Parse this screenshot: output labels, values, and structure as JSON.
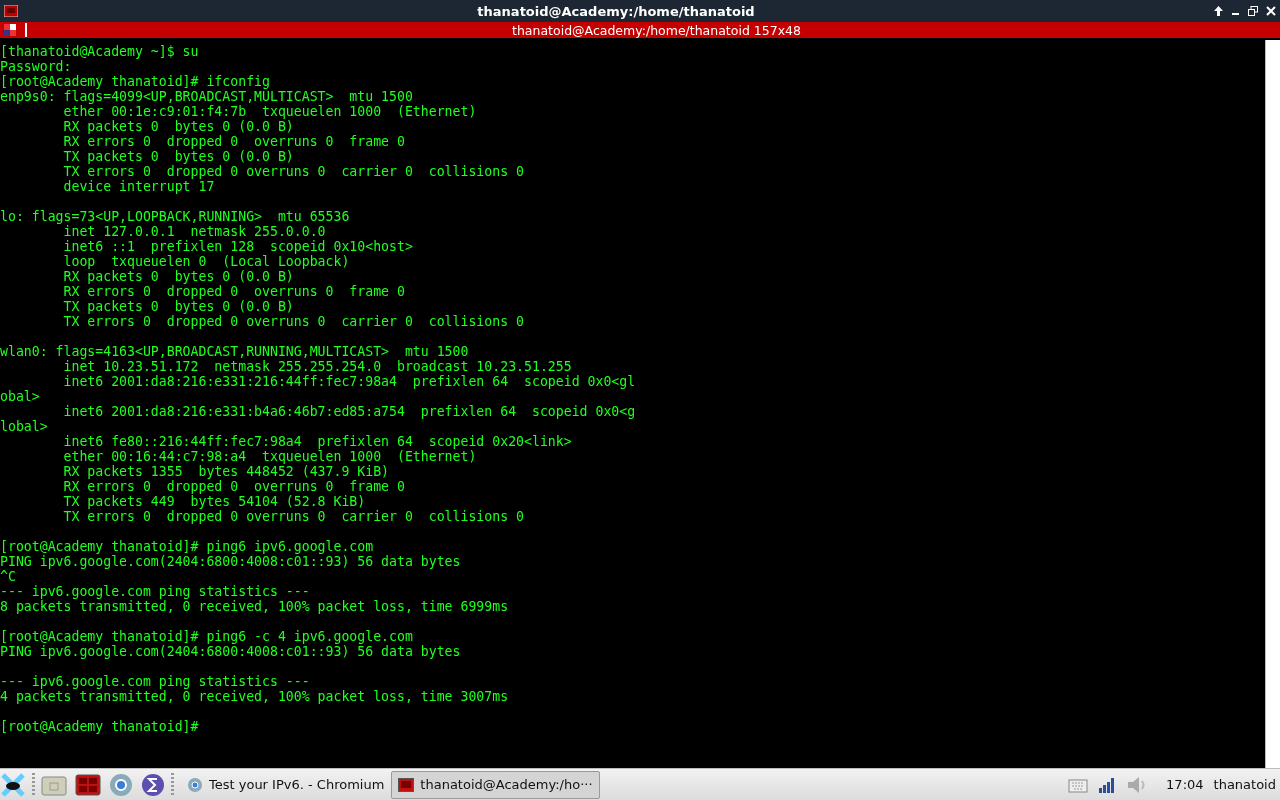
{
  "window": {
    "title": "thanatoid@Academy:/home/thanatoid"
  },
  "tab_bar": {
    "title": "thanatoid@Academy:/home/thanatoid 157x48"
  },
  "terminal": {
    "blocks": [
      [
        "[thanatoid@Academy ~]$ su",
        "Password:",
        "[root@Academy thanatoid]# ifconfig",
        "enp9s0: flags=4099<UP,BROADCAST,MULTICAST>  mtu 1500",
        "        ether 00:1e:c9:01:f4:7b  txqueuelen 1000  (Ethernet)",
        "        RX packets 0  bytes 0 (0.0 B)",
        "        RX errors 0  dropped 0  overruns 0  frame 0",
        "        TX packets 0  bytes 0 (0.0 B)",
        "        TX errors 0  dropped 0 overruns 0  carrier 0  collisions 0",
        "        device interrupt 17"
      ],
      [
        "lo: flags=73<UP,LOOPBACK,RUNNING>  mtu 65536",
        "        inet 127.0.0.1  netmask 255.0.0.0",
        "        inet6 ::1  prefixlen 128  scopeid 0x10<host>",
        "        loop  txqueuelen 0  (Local Loopback)",
        "        RX packets 0  bytes 0 (0.0 B)",
        "        RX errors 0  dropped 0  overruns 0  frame 0",
        "        TX packets 0  bytes 0 (0.0 B)",
        "        TX errors 0  dropped 0 overruns 0  carrier 0  collisions 0"
      ],
      [
        "wlan0: flags=4163<UP,BROADCAST,RUNNING,MULTICAST>  mtu 1500",
        "        inet 10.23.51.172  netmask 255.255.254.0  broadcast 10.23.51.255",
        "        inet6 2001:da8:216:e331:216:44ff:fec7:98a4  prefixlen 64  scopeid 0x0<gl",
        "obal>",
        "        inet6 2001:da8:216:e331:b4a6:46b7:ed85:a754  prefixlen 64  scopeid 0x0<g",
        "lobal>",
        "        inet6 fe80::216:44ff:fec7:98a4  prefixlen 64  scopeid 0x20<link>",
        "        ether 00:16:44:c7:98:a4  txqueuelen 1000  (Ethernet)",
        "        RX packets 1355  bytes 448452 (437.9 KiB)",
        "        RX errors 0  dropped 0  overruns 0  frame 0",
        "        TX packets 449  bytes 54104 (52.8 KiB)",
        "        TX errors 0  dropped 0 overruns 0  carrier 0  collisions 0"
      ],
      [
        "[root@Academy thanatoid]# ping6 ipv6.google.com",
        "PING ipv6.google.com(2404:6800:4008:c01::93) 56 data bytes",
        "^C",
        "--- ipv6.google.com ping statistics ---",
        "8 packets transmitted, 0 received, 100% packet loss, time 6999ms"
      ],
      [
        "[root@Academy thanatoid]# ping6 -c 4 ipv6.google.com",
        "PING ipv6.google.com(2404:6800:4008:c01::93) 56 data bytes"
      ],
      [
        "--- ipv6.google.com ping statistics ---",
        "4 packets transmitted, 0 received, 100% packet loss, time 3007ms"
      ],
      [
        "[root@Academy thanatoid]#"
      ]
    ]
  },
  "taskbar": {
    "tasks": [
      {
        "kind": "browser",
        "label": "Test your IPv6. - Chromium",
        "selected": false
      },
      {
        "kind": "terminal",
        "label": "thanatoid@Academy:/ho···",
        "selected": true
      }
    ],
    "clock": "17:04",
    "user": "thanatoid"
  }
}
